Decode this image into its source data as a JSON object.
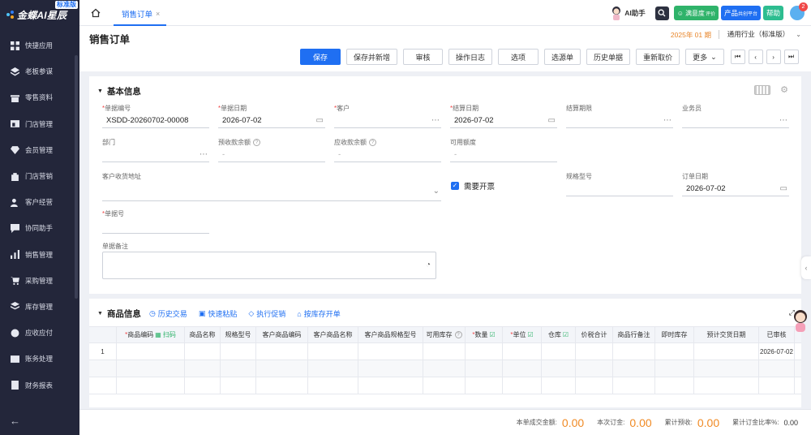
{
  "brand": {
    "name": "金蝶AI星辰",
    "badge": "标准版"
  },
  "sidebar": {
    "items": [
      {
        "label": "快捷应用",
        "icon": "grid-icon"
      },
      {
        "label": "老板参谋",
        "icon": "layers-icon"
      },
      {
        "label": "零售资料",
        "icon": "store-icon"
      },
      {
        "label": "门店管理",
        "icon": "storefront-icon"
      },
      {
        "label": "会员管理",
        "icon": "diamond-icon"
      },
      {
        "label": "门店营销",
        "icon": "bag-icon"
      },
      {
        "label": "客户经营",
        "icon": "people-icon"
      },
      {
        "label": "协同助手",
        "icon": "chat-icon"
      },
      {
        "label": "销售管理",
        "icon": "chart-icon"
      },
      {
        "label": "采购管理",
        "icon": "cart-icon"
      },
      {
        "label": "库存管理",
        "icon": "stack-icon"
      },
      {
        "label": "应收应付",
        "icon": "money-icon"
      },
      {
        "label": "账务处理",
        "icon": "ledger-icon"
      },
      {
        "label": "财务报表",
        "icon": "report-icon"
      }
    ],
    "collapse_glyph": "←"
  },
  "topbar": {
    "tab_label": "销售订单",
    "tab_close": "×",
    "ai_helper": "AI助手",
    "satisfaction": "满意度",
    "satisfaction_sub": "评价",
    "product_platform": "产品",
    "product_platform_sub": "共创平台",
    "help": "帮助",
    "notification_count": "2"
  },
  "header": {
    "title": "销售订单",
    "period": "2025年 01 期",
    "industry": "通用行业（标准版）"
  },
  "toolbar": {
    "buttons": [
      "保存",
      "保存并新增",
      "审核",
      "操作日志",
      "选项",
      "选源单",
      "历史单据",
      "重新取价",
      "更多"
    ],
    "more_arrow": "⌄",
    "nav": [
      "⏮",
      "‹",
      "›",
      "⏭"
    ]
  },
  "basic": {
    "section_title": "基本信息",
    "fields": {
      "doc_no": {
        "label": "单据编号",
        "value": "XSDD-20260702-00008"
      },
      "doc_date": {
        "label": "单据日期",
        "value": "2026-07-02"
      },
      "customer": {
        "label": "客户",
        "value": ""
      },
      "settle_date": {
        "label": "结算日期",
        "value": "2026-07-02"
      },
      "settle_term": {
        "label": "结算期限",
        "value": ""
      },
      "salesman": {
        "label": "业务员",
        "value": ""
      },
      "dept": {
        "label": "部门",
        "value": ""
      },
      "prepay_balance": {
        "label": "预收款余额",
        "value": "-"
      },
      "receivable_balance": {
        "label": "应收款余额",
        "value": "-"
      },
      "available_credit": {
        "label": "可用额度",
        "value": "-"
      },
      "ship_address": {
        "label": "客户收货地址",
        "value": ""
      },
      "need_invoice": {
        "label": "需要开票"
      },
      "spec_model": {
        "label": "规格型号",
        "value": ""
      },
      "order_date": {
        "label": "订单日期",
        "value": "2026-07-02"
      },
      "doc_mark": {
        "label": "单据号",
        "value": ""
      },
      "remark": {
        "label": "单据备注",
        "value": ""
      }
    }
  },
  "product": {
    "section_title": "商品信息",
    "links": [
      "历史交易",
      "快速粘贴",
      "执行促销",
      "按库存开单"
    ],
    "columns": [
      {
        "label": "商品编码",
        "req": true,
        "extra": "扫码"
      },
      {
        "label": "商品名称"
      },
      {
        "label": "规格型号"
      },
      {
        "label": "客户商品编码"
      },
      {
        "label": "客户商品名称"
      },
      {
        "label": "客户商品规格型号"
      },
      {
        "label": "可用库存"
      },
      {
        "label": "数量",
        "req": true
      },
      {
        "label": "单位",
        "req": true
      },
      {
        "label": "仓库"
      },
      {
        "label": "价税合计"
      },
      {
        "label": "商品行备注"
      },
      {
        "label": "即时库存"
      },
      {
        "label": "预计交货日期"
      },
      {
        "label": "已审核"
      }
    ],
    "rows": [
      {
        "index": "1",
        "delivery_date": "2026-07-02"
      }
    ]
  },
  "footer": {
    "amount_label": "本单成交金额:",
    "amount_value": "0.00",
    "deposit_label": "本次订金:",
    "deposit_value": "0.00",
    "prepay_label": "累计预收:",
    "prepay_value": "0.00",
    "ratio_label": "累计订金比率%:",
    "ratio_value": "0.00"
  },
  "colors": {
    "primary": "#1f6ff2",
    "sidebar": "#23263a",
    "amount": "#f08a24",
    "required": "#f04848"
  }
}
